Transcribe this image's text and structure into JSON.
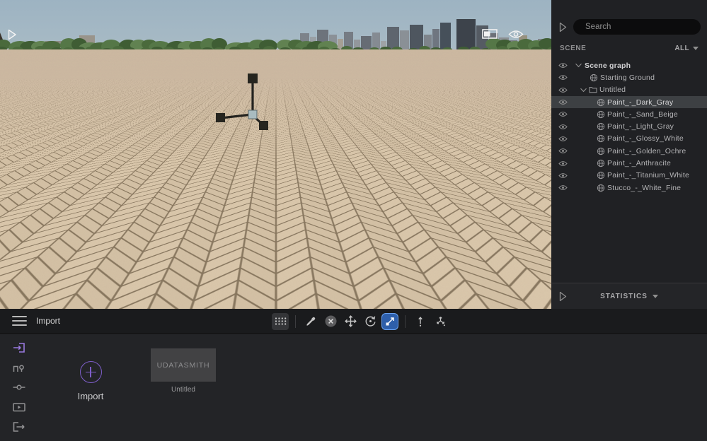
{
  "viewport": {
    "overlays": [
      "collapse-left",
      "panel-toggle",
      "visibility-toggle"
    ],
    "gizmo": "scale-gizmo"
  },
  "scene_panel": {
    "search_placeholder": "Search",
    "section_label": "SCENE",
    "filter_label": "ALL",
    "statistics_label": "STATISTICS",
    "items": [
      {
        "label": "Scene graph",
        "level": 0,
        "bold": true,
        "expanded": true,
        "icon": "none",
        "selected": false
      },
      {
        "label": "Starting Ground",
        "level": 1,
        "bold": false,
        "expanded": false,
        "icon": "object",
        "selected": false
      },
      {
        "label": "Untitled",
        "level": 1,
        "bold": false,
        "expanded": true,
        "icon": "folder",
        "selected": false
      },
      {
        "label": "Paint_-_Dark_Gray",
        "level": 2,
        "bold": false,
        "expanded": false,
        "icon": "object",
        "selected": true
      },
      {
        "label": "Paint_-_Sand_Beige",
        "level": 2,
        "bold": false,
        "expanded": false,
        "icon": "object",
        "selected": false
      },
      {
        "label": "Paint_-_Light_Gray",
        "level": 2,
        "bold": false,
        "expanded": false,
        "icon": "object",
        "selected": false
      },
      {
        "label": "Paint_-_Glossy_White",
        "level": 2,
        "bold": false,
        "expanded": false,
        "icon": "object",
        "selected": false
      },
      {
        "label": "Paint_-_Golden_Ochre",
        "level": 2,
        "bold": false,
        "expanded": false,
        "icon": "object",
        "selected": false
      },
      {
        "label": "Paint_-_Anthracite",
        "level": 2,
        "bold": false,
        "expanded": false,
        "icon": "object",
        "selected": false
      },
      {
        "label": "Paint_-_Titanium_White",
        "level": 2,
        "bold": false,
        "expanded": false,
        "icon": "object",
        "selected": false
      },
      {
        "label": "Stucco_-_White_Fine",
        "level": 2,
        "bold": false,
        "expanded": false,
        "icon": "object",
        "selected": false
      }
    ]
  },
  "toolbar": {
    "menu_label": "Import",
    "tools": [
      "snap-grid",
      "eyedropper",
      "deselect",
      "move",
      "rotate",
      "scale",
      "axis-local",
      "axis-world"
    ],
    "active_tool": "scale"
  },
  "import_panel": {
    "import_button_label": "Import",
    "card_title": "UDATASMITH",
    "card_subtitle": "Untitled",
    "dock_items": [
      "import",
      "objects",
      "links",
      "media",
      "export"
    ],
    "active_dock_item": "import"
  },
  "icons": {
    "search": "magnifier",
    "collapse": "triangle-right",
    "visibility": "eye",
    "expander": "chevron-down",
    "folder": "folder-outline",
    "object": "wireframe-sphere",
    "menu": "hamburger",
    "snap-grid": "dot-grid",
    "eyedropper": "pipette",
    "deselect": "circle-x",
    "move": "cross-arrows",
    "rotate": "circular-arrow-dot",
    "scale": "diagonal-arrow-squares",
    "axis-local": "vertical-arrow-dot",
    "axis-world": "tri-arrows-dot",
    "dock-import": "arrow-into-box",
    "dock-objects": "step-probe",
    "dock-links": "line-node",
    "dock-media": "play-rectangle",
    "dock-export": "arrow-out-of-box",
    "add": "plus-circle"
  },
  "colors": {
    "accent_purple": "#7e5ec9",
    "active_tool_blue": "#2e5faa",
    "active_tool_border": "#6aa2f0",
    "selection_bg": "#3d4043",
    "panel_bg": "#202124",
    "toolbar_bg": "#1a1b1d",
    "bottom_bg": "#232427",
    "ground_brick": "#d9c6aa",
    "ground_grout": "#6f5e48",
    "sky_top": "#9db3c2"
  }
}
